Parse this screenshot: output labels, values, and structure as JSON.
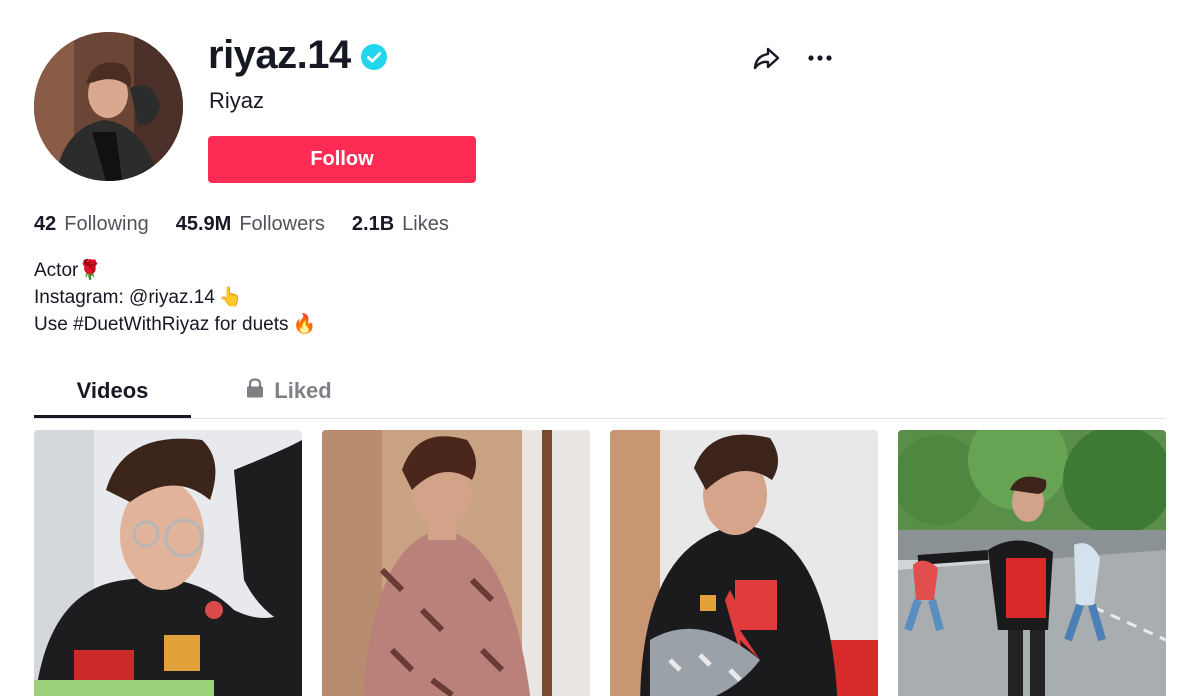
{
  "profile": {
    "username": "riyaz.14",
    "display_name": "Riyaz",
    "verified_icon": "verified-badge-icon",
    "follow_label": "Follow"
  },
  "actions": {
    "share_icon": "share-arrow-icon",
    "more_icon": "more-dots-icon"
  },
  "stats": {
    "following_count": "42",
    "following_label": "Following",
    "followers_count": "45.9M",
    "followers_label": "Followers",
    "likes_count": "2.1B",
    "likes_label": "Likes"
  },
  "bio": {
    "line1": "Actor",
    "line1_emoji": "🌹",
    "line2": "Instagram: @riyaz.14",
    "line2_emoji": "👆",
    "line3": "Use #DuetWithRiyaz for duets",
    "line3_emoji": "🔥"
  },
  "tabs": [
    {
      "label": "Videos",
      "active": true
    },
    {
      "label": "Liked",
      "active": false,
      "icon": "lock-icon"
    }
  ],
  "colors": {
    "accent": "#fe2c55",
    "verified": "#20d5ec",
    "text": "#161823"
  }
}
